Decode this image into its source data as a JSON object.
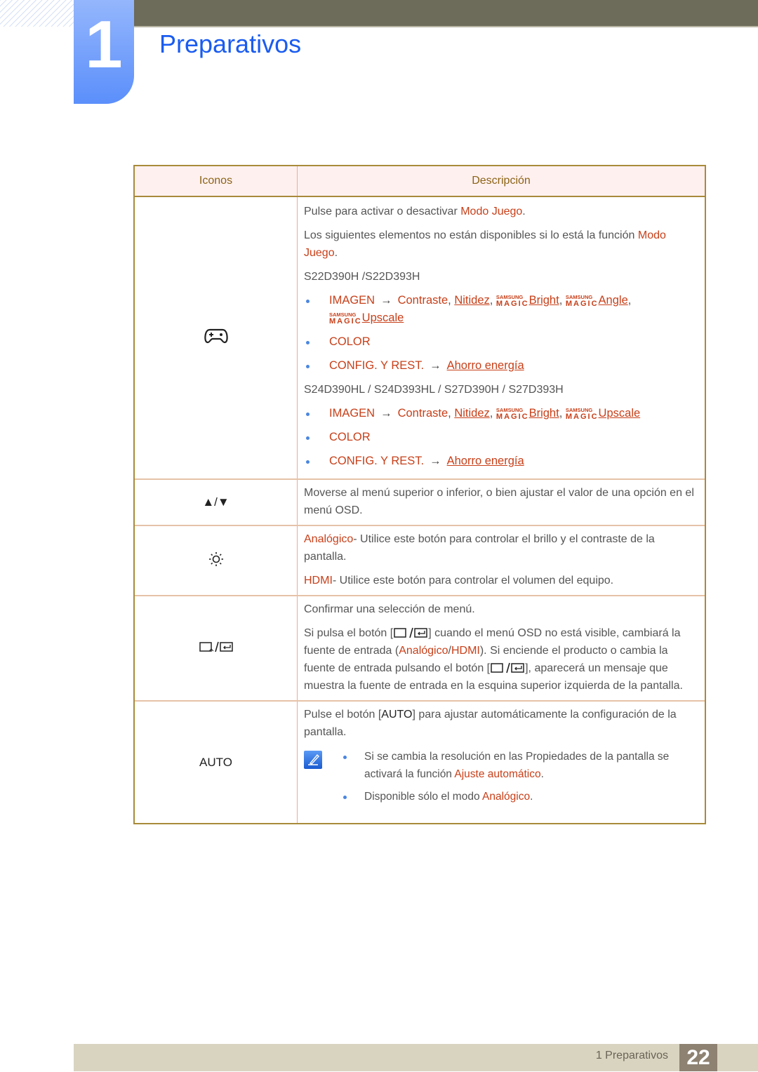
{
  "header": {
    "chapter_number": "1",
    "title": "Preparativos"
  },
  "table": {
    "col_icons": "Iconos",
    "col_desc": "Descripción",
    "rows": [
      {
        "icon": "gamepad-icon",
        "p1_prefix": "Pulse para activar o desactivar ",
        "p1_hl": "Modo Juego",
        "p1_suffix": ".",
        "p2_prefix": "Los siguientes elementos no están disponibles si lo está la función ",
        "p2_hl": "Modo Juego",
        "p2_suffix": ".",
        "models_a": "S22D390H /S22D393H",
        "models_b": "S24D390HL / S24D393HL / S27D390H / S27D393H",
        "list_a": {
          "imagen": "IMAGEN",
          "arrow": "→",
          "contraste": "Contraste",
          "nitidez": "Nitidez",
          "bright": "Bright",
          "angle": "Angle",
          "upscale": "Upscale",
          "color": "COLOR",
          "config": "CONFIG. Y REST.",
          "ahorro": "Ahorro energía"
        },
        "list_b": {
          "imagen": "IMAGEN",
          "arrow": "→",
          "contraste": "Contraste",
          "nitidez": "Nitidez",
          "bright": "Bright",
          "upscale": "Upscale",
          "color": "COLOR",
          "config": "CONFIG. Y REST.",
          "ahorro": "Ahorro energía"
        },
        "magic_top": "SAMSUNG",
        "magic_bottom": "MAGIC",
        "comma": ",",
        "sep": ", "
      },
      {
        "icon_text": "▲/▼",
        "desc": "Moverse al menú superior o inferior, o bien ajustar el valor de una opción en el menú OSD."
      },
      {
        "icon": "brightness-icon",
        "analog_hl": "Analógico",
        "analog_text": "- Utilice este botón para controlar el brillo y el contraste de la pantalla.",
        "hdmi_hl": "HDMI",
        "hdmi_text": "- Utilice este botón para controlar el volumen del equipo."
      },
      {
        "icon": "source-enter-icon",
        "p1": "Confirmar una selección de menú.",
        "p2_a": "Si pulsa el botón [",
        "p2_b": "] cuando el menú OSD no está visible, cambiará la fuente de entrada (",
        "p2_hl1": "Analógico",
        "p2_slash": "/",
        "p2_hl2": "HDMI",
        "p2_c": "). Si enciende el producto o cambia la fuente de entrada pulsando el botón [",
        "p2_d": "], aparecerá un mensaje que muestra la fuente de entrada en la esquina superior izquierda de la pantalla."
      },
      {
        "icon_text": "AUTO",
        "p1_a": "Pulse el botón [",
        "p1_key": "AUTO",
        "p1_b": "] para ajustar automáticamente la configuración de la pantalla.",
        "note1_a": "Si se cambia la resolución en las Propiedades de la pantalla se activará la función ",
        "note1_hl": "Ajuste automático",
        "note1_b": ".",
        "note2_a": "Disponible sólo el modo ",
        "note2_hl": "Analógico",
        "note2_b": "."
      }
    ]
  },
  "footer": {
    "section": "1 Preparativos",
    "page": "22"
  }
}
